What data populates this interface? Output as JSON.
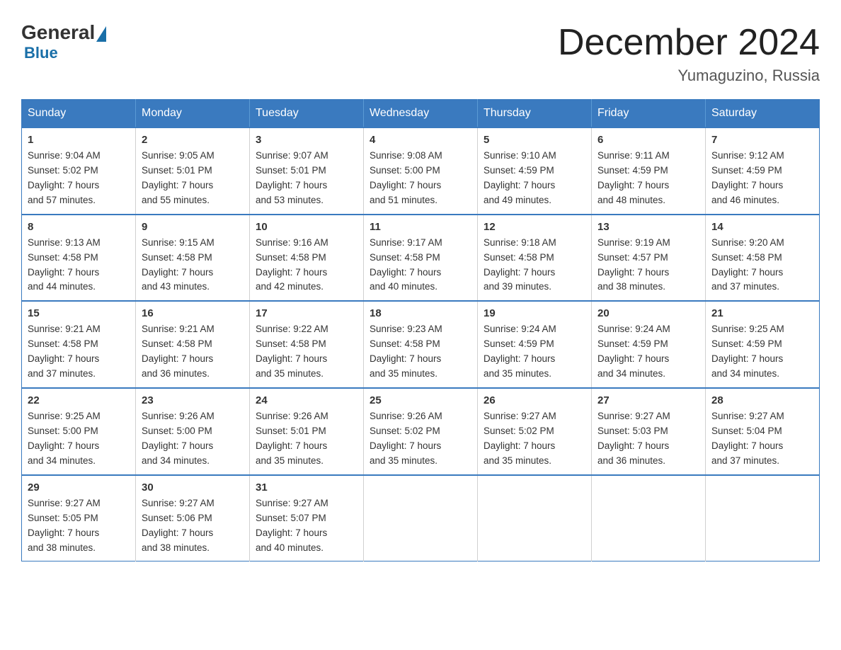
{
  "logo": {
    "general": "General",
    "blue": "Blue"
  },
  "title": {
    "month_year": "December 2024",
    "location": "Yumaguzino, Russia"
  },
  "weekdays": [
    "Sunday",
    "Monday",
    "Tuesday",
    "Wednesday",
    "Thursday",
    "Friday",
    "Saturday"
  ],
  "weeks": [
    [
      {
        "day": 1,
        "sunrise": "9:04 AM",
        "sunset": "5:02 PM",
        "daylight": "7 hours and 57 minutes."
      },
      {
        "day": 2,
        "sunrise": "9:05 AM",
        "sunset": "5:01 PM",
        "daylight": "7 hours and 55 minutes."
      },
      {
        "day": 3,
        "sunrise": "9:07 AM",
        "sunset": "5:01 PM",
        "daylight": "7 hours and 53 minutes."
      },
      {
        "day": 4,
        "sunrise": "9:08 AM",
        "sunset": "5:00 PM",
        "daylight": "7 hours and 51 minutes."
      },
      {
        "day": 5,
        "sunrise": "9:10 AM",
        "sunset": "4:59 PM",
        "daylight": "7 hours and 49 minutes."
      },
      {
        "day": 6,
        "sunrise": "9:11 AM",
        "sunset": "4:59 PM",
        "daylight": "7 hours and 48 minutes."
      },
      {
        "day": 7,
        "sunrise": "9:12 AM",
        "sunset": "4:59 PM",
        "daylight": "7 hours and 46 minutes."
      }
    ],
    [
      {
        "day": 8,
        "sunrise": "9:13 AM",
        "sunset": "4:58 PM",
        "daylight": "7 hours and 44 minutes."
      },
      {
        "day": 9,
        "sunrise": "9:15 AM",
        "sunset": "4:58 PM",
        "daylight": "7 hours and 43 minutes."
      },
      {
        "day": 10,
        "sunrise": "9:16 AM",
        "sunset": "4:58 PM",
        "daylight": "7 hours and 42 minutes."
      },
      {
        "day": 11,
        "sunrise": "9:17 AM",
        "sunset": "4:58 PM",
        "daylight": "7 hours and 40 minutes."
      },
      {
        "day": 12,
        "sunrise": "9:18 AM",
        "sunset": "4:58 PM",
        "daylight": "7 hours and 39 minutes."
      },
      {
        "day": 13,
        "sunrise": "9:19 AM",
        "sunset": "4:57 PM",
        "daylight": "7 hours and 38 minutes."
      },
      {
        "day": 14,
        "sunrise": "9:20 AM",
        "sunset": "4:58 PM",
        "daylight": "7 hours and 37 minutes."
      }
    ],
    [
      {
        "day": 15,
        "sunrise": "9:21 AM",
        "sunset": "4:58 PM",
        "daylight": "7 hours and 37 minutes."
      },
      {
        "day": 16,
        "sunrise": "9:21 AM",
        "sunset": "4:58 PM",
        "daylight": "7 hours and 36 minutes."
      },
      {
        "day": 17,
        "sunrise": "9:22 AM",
        "sunset": "4:58 PM",
        "daylight": "7 hours and 35 minutes."
      },
      {
        "day": 18,
        "sunrise": "9:23 AM",
        "sunset": "4:58 PM",
        "daylight": "7 hours and 35 minutes."
      },
      {
        "day": 19,
        "sunrise": "9:24 AM",
        "sunset": "4:59 PM",
        "daylight": "7 hours and 35 minutes."
      },
      {
        "day": 20,
        "sunrise": "9:24 AM",
        "sunset": "4:59 PM",
        "daylight": "7 hours and 34 minutes."
      },
      {
        "day": 21,
        "sunrise": "9:25 AM",
        "sunset": "4:59 PM",
        "daylight": "7 hours and 34 minutes."
      }
    ],
    [
      {
        "day": 22,
        "sunrise": "9:25 AM",
        "sunset": "5:00 PM",
        "daylight": "7 hours and 34 minutes."
      },
      {
        "day": 23,
        "sunrise": "9:26 AM",
        "sunset": "5:00 PM",
        "daylight": "7 hours and 34 minutes."
      },
      {
        "day": 24,
        "sunrise": "9:26 AM",
        "sunset": "5:01 PM",
        "daylight": "7 hours and 35 minutes."
      },
      {
        "day": 25,
        "sunrise": "9:26 AM",
        "sunset": "5:02 PM",
        "daylight": "7 hours and 35 minutes."
      },
      {
        "day": 26,
        "sunrise": "9:27 AM",
        "sunset": "5:02 PM",
        "daylight": "7 hours and 35 minutes."
      },
      {
        "day": 27,
        "sunrise": "9:27 AM",
        "sunset": "5:03 PM",
        "daylight": "7 hours and 36 minutes."
      },
      {
        "day": 28,
        "sunrise": "9:27 AM",
        "sunset": "5:04 PM",
        "daylight": "7 hours and 37 minutes."
      }
    ],
    [
      {
        "day": 29,
        "sunrise": "9:27 AM",
        "sunset": "5:05 PM",
        "daylight": "7 hours and 38 minutes."
      },
      {
        "day": 30,
        "sunrise": "9:27 AM",
        "sunset": "5:06 PM",
        "daylight": "7 hours and 38 minutes."
      },
      {
        "day": 31,
        "sunrise": "9:27 AM",
        "sunset": "5:07 PM",
        "daylight": "7 hours and 40 minutes."
      },
      null,
      null,
      null,
      null
    ]
  ],
  "labels": {
    "sunrise": "Sunrise:",
    "sunset": "Sunset:",
    "daylight": "Daylight:"
  }
}
